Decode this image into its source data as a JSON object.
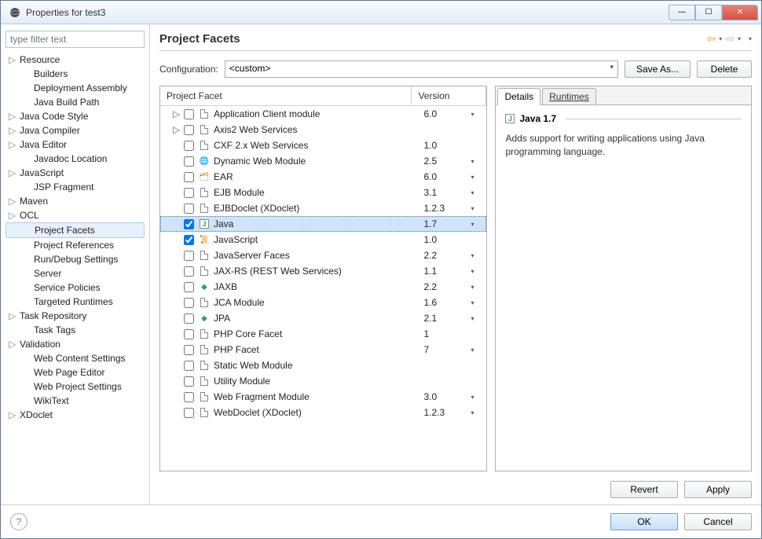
{
  "titlebar": {
    "title": "Properties for test3"
  },
  "sidebar": {
    "filter_placeholder": "type filter text",
    "items": [
      {
        "label": "Resource",
        "expandable": true,
        "children": []
      },
      {
        "label": "Builders"
      },
      {
        "label": "Deployment Assembly"
      },
      {
        "label": "Java Build Path"
      },
      {
        "label": "Java Code Style",
        "expandable": true
      },
      {
        "label": "Java Compiler",
        "expandable": true
      },
      {
        "label": "Java Editor",
        "expandable": true
      },
      {
        "label": "Javadoc Location"
      },
      {
        "label": "JavaScript",
        "expandable": true
      },
      {
        "label": "JSP Fragment"
      },
      {
        "label": "Maven",
        "expandable": true
      },
      {
        "label": "OCL",
        "expandable": true
      },
      {
        "label": "Project Facets",
        "selected": true
      },
      {
        "label": "Project References"
      },
      {
        "label": "Run/Debug Settings"
      },
      {
        "label": "Server"
      },
      {
        "label": "Service Policies"
      },
      {
        "label": "Targeted Runtimes"
      },
      {
        "label": "Task Repository",
        "expandable": true
      },
      {
        "label": "Task Tags"
      },
      {
        "label": "Validation",
        "expandable": true
      },
      {
        "label": "Web Content Settings"
      },
      {
        "label": "Web Page Editor"
      },
      {
        "label": "Web Project Settings"
      },
      {
        "label": "WikiText"
      },
      {
        "label": "XDoclet",
        "expandable": true
      }
    ]
  },
  "main": {
    "title": "Project Facets",
    "config_label": "Configuration:",
    "config_value": "<custom>",
    "save_as": "Save As...",
    "delete": "Delete",
    "columns": {
      "name": "Project Facet",
      "version": "Version"
    }
  },
  "facets": [
    {
      "name": "Application Client module",
      "version": "6.0",
      "expandable": true,
      "dd": true
    },
    {
      "name": "Axis2 Web Services",
      "expandable": true,
      "expanded": false
    },
    {
      "name": "CXF 2.x Web Services",
      "version": "1.0"
    },
    {
      "name": "Dynamic Web Module",
      "version": "2.5",
      "dd": true,
      "globe": true
    },
    {
      "name": "EAR",
      "version": "6.0",
      "dd": true,
      "jar": true
    },
    {
      "name": "EJB Module",
      "version": "3.1",
      "dd": true
    },
    {
      "name": "EJBDoclet (XDoclet)",
      "version": "1.2.3",
      "dd": true
    },
    {
      "name": "Java",
      "version": "1.7",
      "dd": true,
      "checked": true,
      "selected": true,
      "jicon": true
    },
    {
      "name": "JavaScript",
      "version": "1.0",
      "checked": true,
      "js": true
    },
    {
      "name": "JavaServer Faces",
      "version": "2.2",
      "dd": true
    },
    {
      "name": "JAX-RS (REST Web Services)",
      "version": "1.1",
      "dd": true
    },
    {
      "name": "JAXB",
      "version": "2.2",
      "dd": true,
      "diamond": true
    },
    {
      "name": "JCA Module",
      "version": "1.6",
      "dd": true
    },
    {
      "name": "JPA",
      "version": "2.1",
      "dd": true,
      "diamond": true
    },
    {
      "name": "PHP Core Facet",
      "version": "1"
    },
    {
      "name": "PHP Facet",
      "version": "7",
      "dd": true
    },
    {
      "name": "Static Web Module"
    },
    {
      "name": "Utility Module"
    },
    {
      "name": "Web Fragment Module",
      "version": "3.0",
      "dd": true
    },
    {
      "name": "WebDoclet (XDoclet)",
      "version": "1.2.3",
      "dd": true
    }
  ],
  "details": {
    "tab_details": "Details",
    "tab_runtimes": "Runtimes",
    "title": "Java 1.7",
    "desc": "Adds support for writing applications using Java programming language."
  },
  "buttons": {
    "revert": "Revert",
    "apply": "Apply",
    "ok": "OK",
    "cancel": "Cancel"
  }
}
